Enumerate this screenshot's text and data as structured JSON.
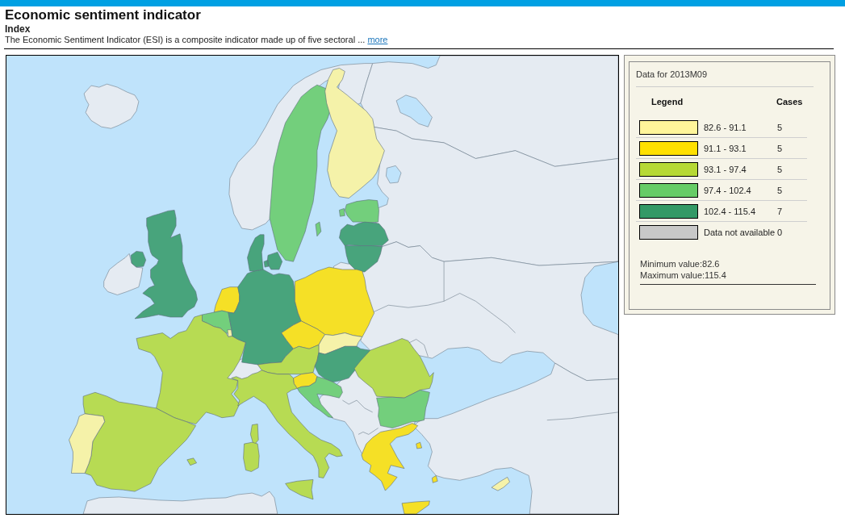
{
  "page": {
    "title": "Economic sentiment indicator",
    "subtitle": "Index",
    "description": "The Economic Sentiment Indicator (ESI) is a composite indicator made up of five sectoral ...",
    "more_link": "more"
  },
  "legend": {
    "period": "Data for 2013M09",
    "heading": "Legend",
    "cases_heading": "Cases",
    "classes": [
      {
        "label": "82.6 - 91.1",
        "cases": "5",
        "color": "#fff59a"
      },
      {
        "label": "91.1 - 93.1",
        "cases": "5",
        "color": "#ffe000"
      },
      {
        "label": "93.1 - 97.4",
        "cases": "5",
        "color": "#b6d935"
      },
      {
        "label": "97.4 - 102.4",
        "cases": "5",
        "color": "#66cc66"
      },
      {
        "label": "102.4 - 115.4",
        "cases": "7",
        "color": "#339966"
      },
      {
        "label": "Data not available",
        "cases": "0",
        "color": "#c8c8c8"
      }
    ],
    "minimum": "Minimum value:82.6",
    "maximum": "Maximum value:115.4"
  }
}
